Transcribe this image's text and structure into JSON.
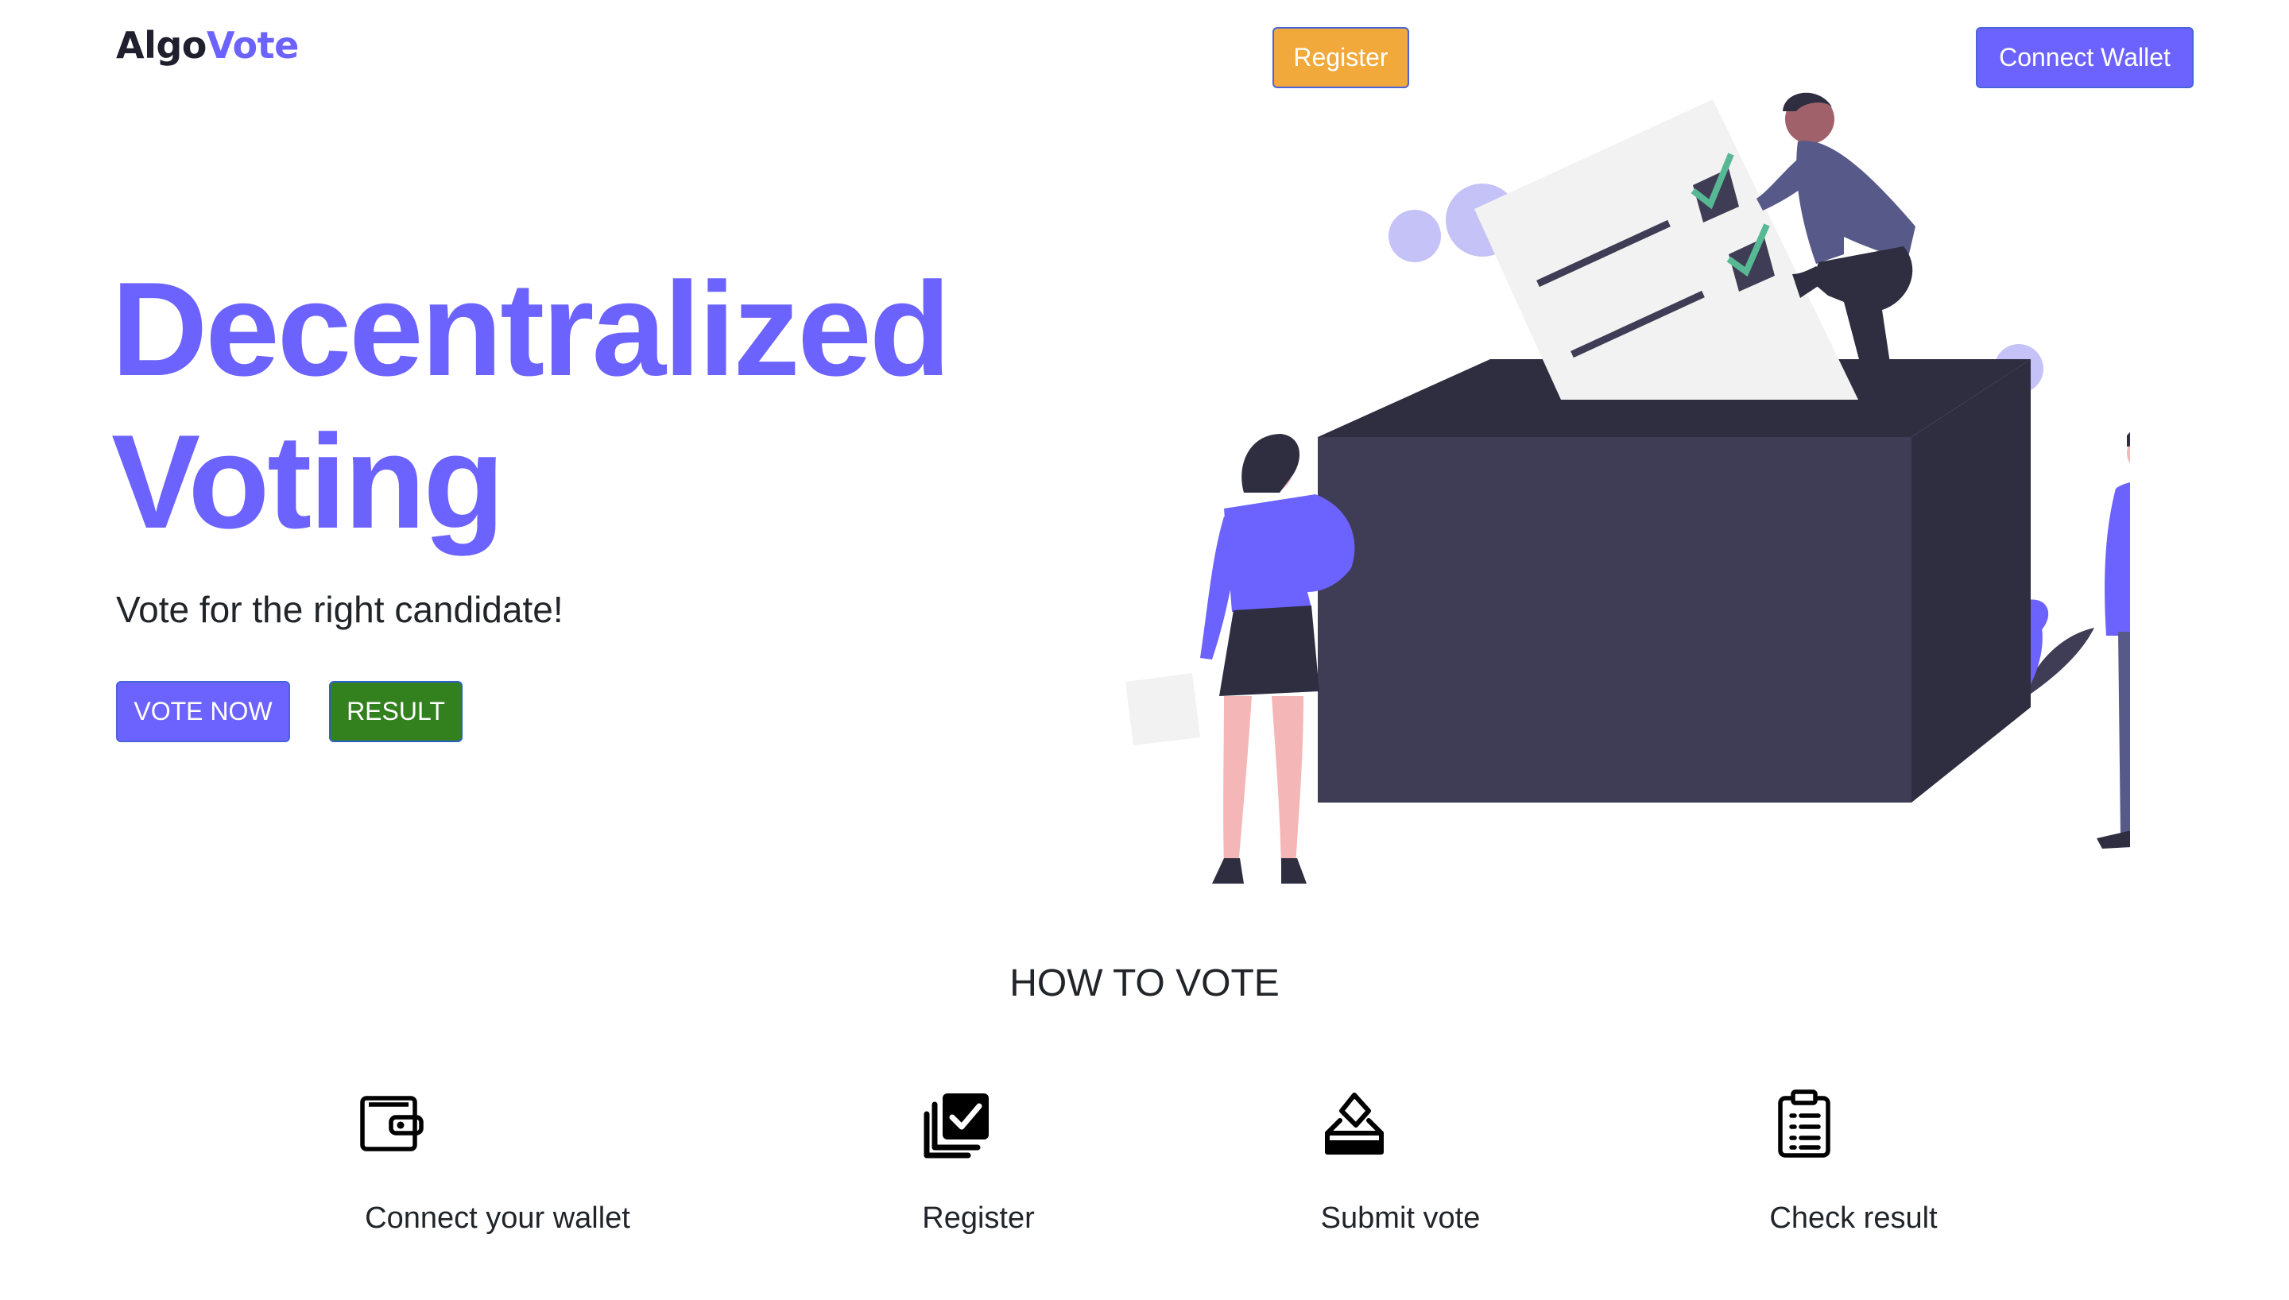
{
  "header": {
    "logo_part1": "Algo",
    "logo_part2": "Vote",
    "register_label": "Register",
    "connect_label": "Connect Wallet"
  },
  "hero": {
    "title_line1": "Decentralized",
    "title_line2": "Voting",
    "subtitle": "Vote for the right candidate!",
    "vote_label": "VOTE NOW",
    "result_label": "RESULT"
  },
  "how_to_vote": {
    "title": "HOW TO VOTE",
    "steps": [
      {
        "label": "Connect your wallet",
        "icon": "wallet-icon"
      },
      {
        "label": "Register",
        "icon": "checkbox-stack-icon"
      },
      {
        "label": "Submit vote",
        "icon": "ballot-box-icon"
      },
      {
        "label": "Check result",
        "icon": "clipboard-list-icon"
      }
    ]
  },
  "colors": {
    "accent": "#6c63ff",
    "register": "#f2a93b",
    "result": "#33801f",
    "dark": "#3f3d56"
  }
}
